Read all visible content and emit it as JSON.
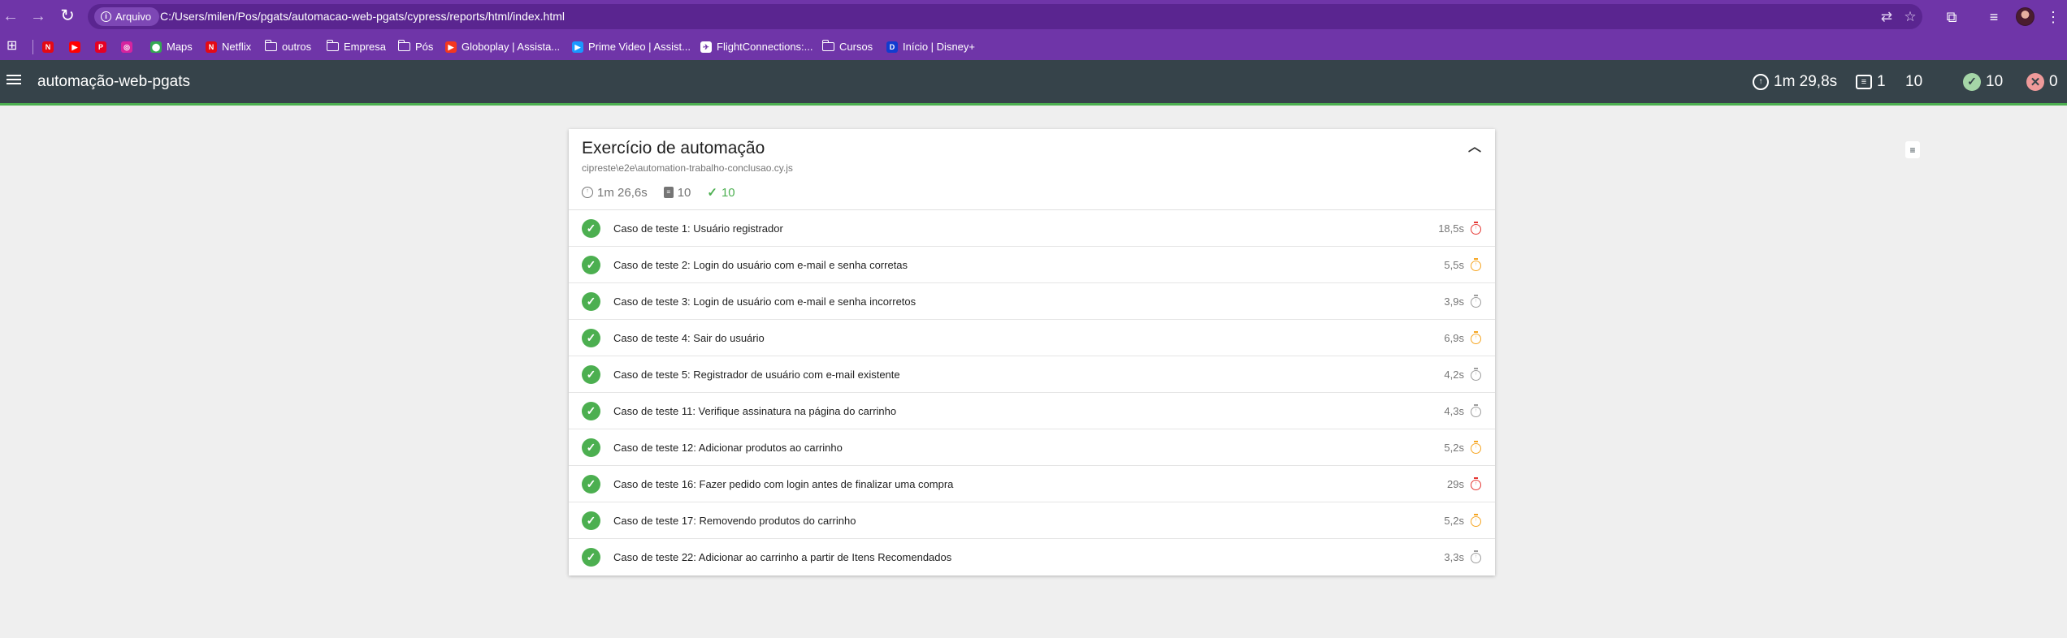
{
  "browser": {
    "back_glyph": "←",
    "forward_glyph": "→",
    "reload_glyph": "↻",
    "chip_label": "Arquivo",
    "url": "C:/Users/milen/Pos/pgats/automacao-web-pgats/cypress/reports/html/index.html",
    "icons": [
      "translate-icon",
      "star-icon",
      "extensions-icon",
      "tab-search-icon",
      "profile-avatar",
      "kebab-menu-icon"
    ],
    "colors": {
      "frame": "#6f35a8",
      "omnibox": "#5a2590"
    }
  },
  "bookmarks": [
    {
      "label": "",
      "icon": "netflix-icon",
      "color": "#e50914",
      "glyph": "N"
    },
    {
      "label": "",
      "icon": "youtube-icon",
      "color": "#ff0000",
      "glyph": "▶"
    },
    {
      "label": "",
      "icon": "pinterest-icon",
      "color": "#e60023",
      "glyph": "P"
    },
    {
      "label": "",
      "icon": "instagram-icon",
      "color": "#d6249f",
      "glyph": "◎"
    },
    {
      "label": "Maps",
      "icon": "maps-icon",
      "color": "#34a853",
      "glyph": "⬤"
    },
    {
      "label": "Netflix",
      "icon": "netflix-icon",
      "color": "#e50914",
      "glyph": "N"
    },
    {
      "label": "outros",
      "icon": "folder-icon"
    },
    {
      "label": "Empresa",
      "icon": "folder-icon"
    },
    {
      "label": "Pós",
      "icon": "folder-icon"
    },
    {
      "label": "Globoplay | Assista...",
      "icon": "globoplay-icon",
      "color": "#f5371d",
      "glyph": "▶"
    },
    {
      "label": "Prime Video | Assist...",
      "icon": "prime-video-icon",
      "color": "#1a98ff",
      "glyph": "▶"
    },
    {
      "label": "FlightConnections:...",
      "icon": "flightconnections-icon",
      "color": "#ffffff",
      "glyph": "✈"
    },
    {
      "label": "Cursos",
      "icon": "folder-icon"
    },
    {
      "label": "Início | Disney+",
      "icon": "disney-plus-icon",
      "color": "#113ccf",
      "glyph": "D"
    }
  ],
  "app": {
    "title": "automação-web-pgats",
    "stats": {
      "duration": "1m 29,8s",
      "suites": "1",
      "tests": "10",
      "passed": "10",
      "failed": "0"
    },
    "colors": {
      "appbar": "#36434a",
      "passed": "#4caf50",
      "failed": "#ef9a9a"
    }
  },
  "suite": {
    "title": "Exercício de automação",
    "file": "cipreste\\e2e\\automation-trabalho-conclusao.cy.js",
    "duration": "1m 26,6s",
    "tests_count": "10",
    "passed_count": "10",
    "tests": [
      {
        "title": "Caso de teste 1: Usuário registrador",
        "duration": "18,5s",
        "speed": "slow"
      },
      {
        "title": "Caso de teste 2: Login do usuário com e-mail e senha corretas",
        "duration": "5,5s",
        "speed": "medium"
      },
      {
        "title": "Caso de teste 3: Login de usuário com e-mail e senha incorretos",
        "duration": "3,9s",
        "speed": "fast"
      },
      {
        "title": "Caso de teste 4: Sair do usuário",
        "duration": "6,9s",
        "speed": "medium"
      },
      {
        "title": "Caso de teste 5: Registrador de usuário com e-mail existente",
        "duration": "4,2s",
        "speed": "fast"
      },
      {
        "title": "Caso de teste 11: Verifique assinatura na página do carrinho",
        "duration": "4,3s",
        "speed": "fast"
      },
      {
        "title": "Caso de teste 12: Adicionar produtos ao carrinho",
        "duration": "5,2s",
        "speed": "medium"
      },
      {
        "title": "Caso de teste 16: Fazer pedido com login antes de finalizar uma compra",
        "duration": "29s",
        "speed": "slow"
      },
      {
        "title": "Caso de teste 17: Removendo produtos do carrinho",
        "duration": "5,2s",
        "speed": "medium"
      },
      {
        "title": "Caso de teste 22: Adicionar ao carrinho a partir de Itens Recomendados",
        "duration": "3,3s",
        "speed": "fast"
      }
    ],
    "speed_colors": {
      "slow": "#e53935",
      "medium": "#f6a623",
      "fast": "#9e9e9e"
    }
  }
}
